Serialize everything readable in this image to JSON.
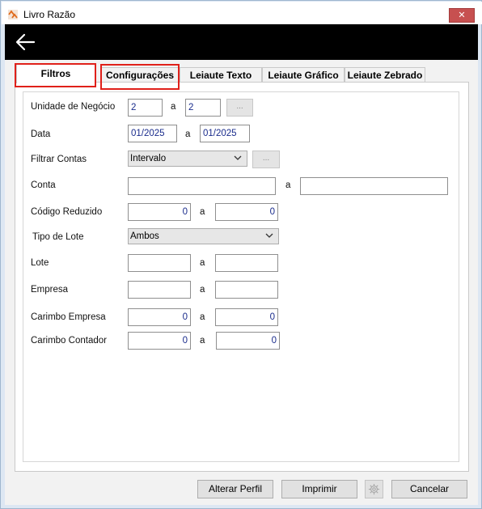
{
  "window": {
    "title": "Livro Razão",
    "close_glyph": "✕"
  },
  "tabs": [
    {
      "label": "Filtros",
      "active": true
    },
    {
      "label": "Configurações",
      "active": false
    },
    {
      "label": "Leiaute Texto",
      "active": false
    },
    {
      "label": "Leiaute Gráfico",
      "active": false
    },
    {
      "label": "Leiaute Zebrado",
      "active": false
    }
  ],
  "form": {
    "separator": "a",
    "unidade": {
      "label": "Unidade de Negócio",
      "from": "2",
      "to": "2",
      "browse": "..."
    },
    "data": {
      "label": "Data",
      "from": "01/2025",
      "to": "01/2025"
    },
    "filtrar_contas": {
      "label": "Filtrar Contas",
      "selected": "Intervalo",
      "browse": "..."
    },
    "conta": {
      "label": "Conta",
      "from": "",
      "to": ""
    },
    "codigo_reduzido": {
      "label": "Código Reduzido",
      "from": "0",
      "to": "0"
    },
    "tipo_lote": {
      "label": "Tipo de Lote",
      "selected": "Ambos"
    },
    "lote": {
      "label": "Lote",
      "from": "",
      "to": ""
    },
    "empresa": {
      "label": "Empresa",
      "from": "",
      "to": ""
    },
    "carimbo_empresa": {
      "label": "Carimbo Empresa",
      "from": "0",
      "to": "0"
    },
    "carimbo_contador": {
      "label": "Carimbo Contador",
      "from": "0",
      "to": "0"
    }
  },
  "buttons": {
    "alterar_perfil": "Alterar Perfil",
    "imprimir": "Imprimir",
    "cancelar": "Cancelar"
  },
  "icons": [
    "app-icon",
    "close-icon",
    "back-arrow-icon",
    "chevron-down-icon",
    "gear-icon"
  ],
  "colors": {
    "highlight_box": "#e0201a",
    "header_bar": "#000000",
    "input_text": "#1a2c8c"
  }
}
